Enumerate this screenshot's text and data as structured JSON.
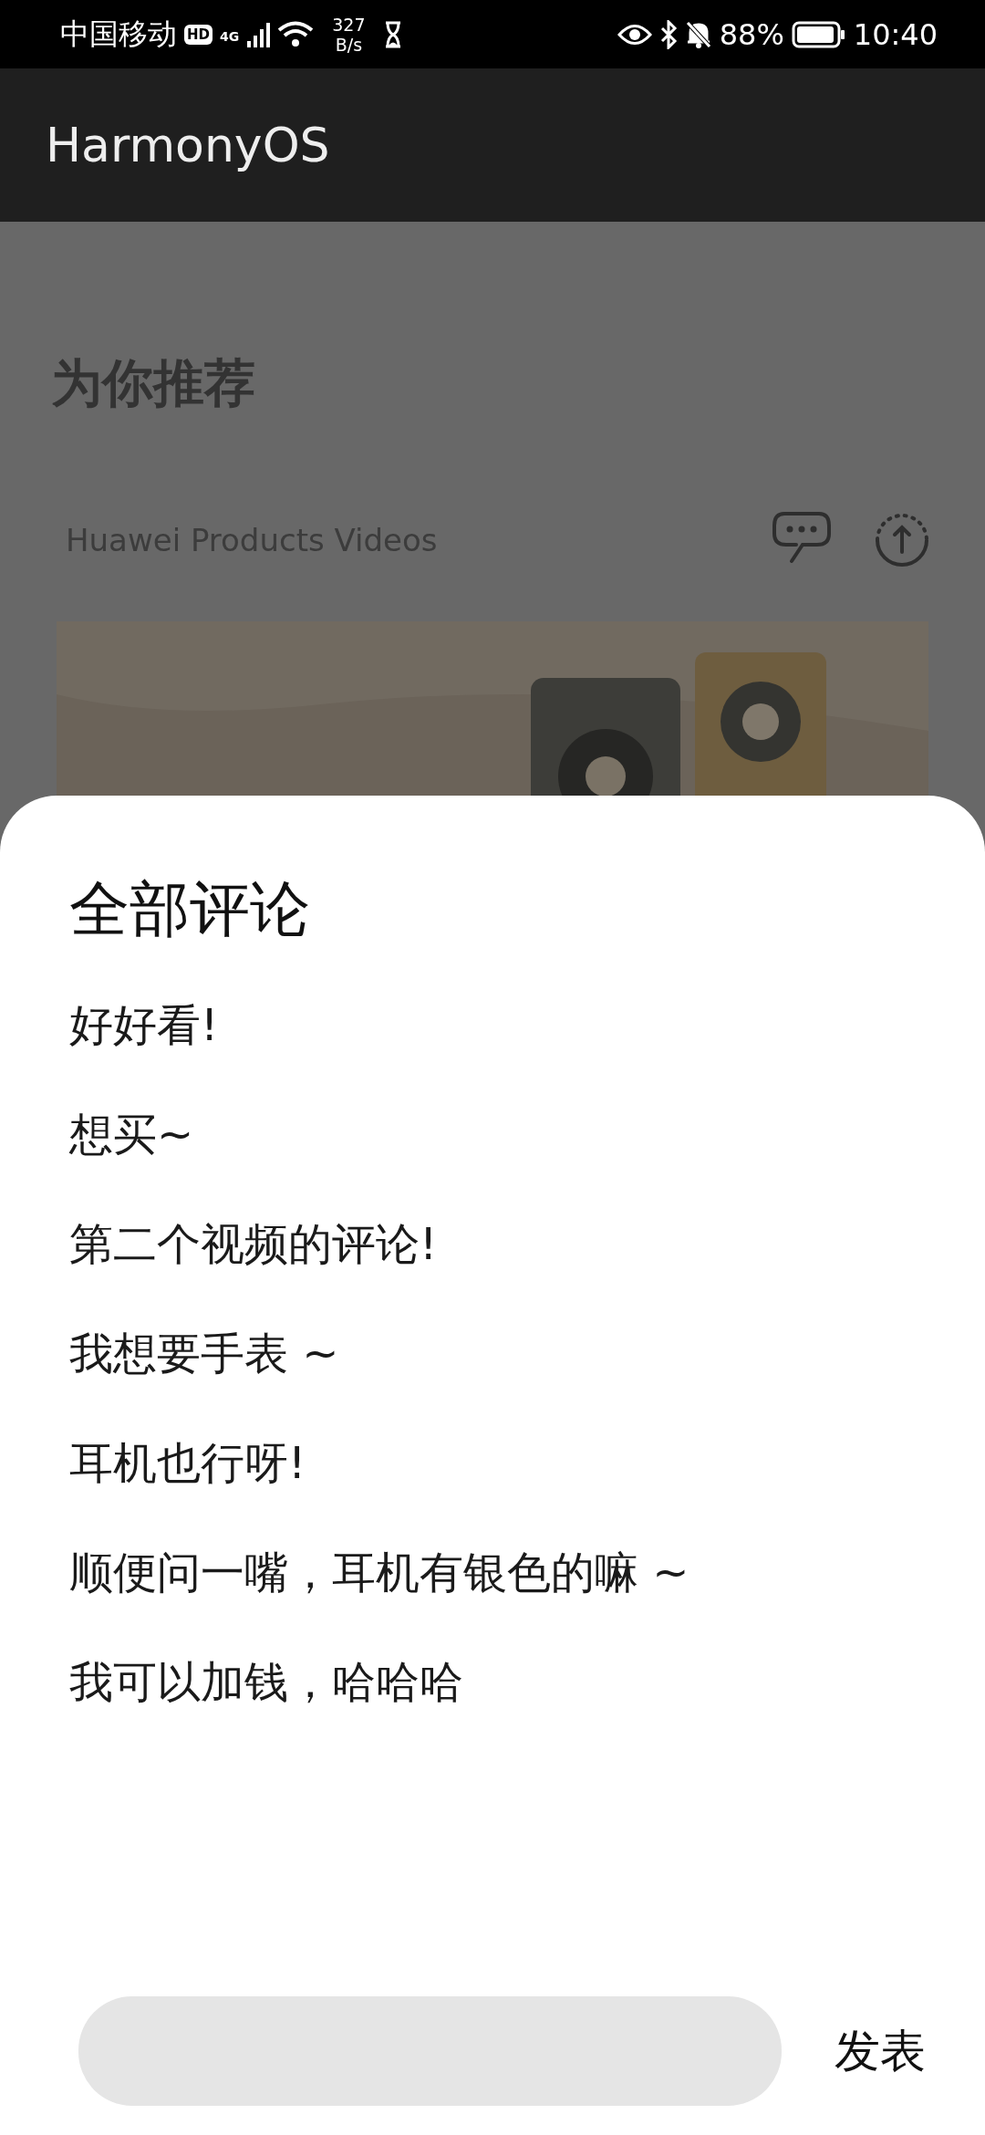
{
  "status_bar": {
    "carrier": "中国移动",
    "hd_badge": "HD",
    "network_type": "4G",
    "speed_value": "327",
    "speed_unit": "B/s",
    "battery": "88%",
    "time": "10:40"
  },
  "app_bar": {
    "title": "HarmonyOS"
  },
  "section_title": "为你推荐",
  "video_card": {
    "channel": "Huawei Products Videos"
  },
  "comments_sheet": {
    "title": "全部评论",
    "comments": [
      "好好看!",
      "想买~",
      "第二个视频的评论!",
      "我想要手表 ~",
      "耳机也行呀!",
      "顺便问一嘴，耳机有银色的嘛 ~",
      "我可以加钱，哈哈哈"
    ],
    "submit": "发表"
  }
}
